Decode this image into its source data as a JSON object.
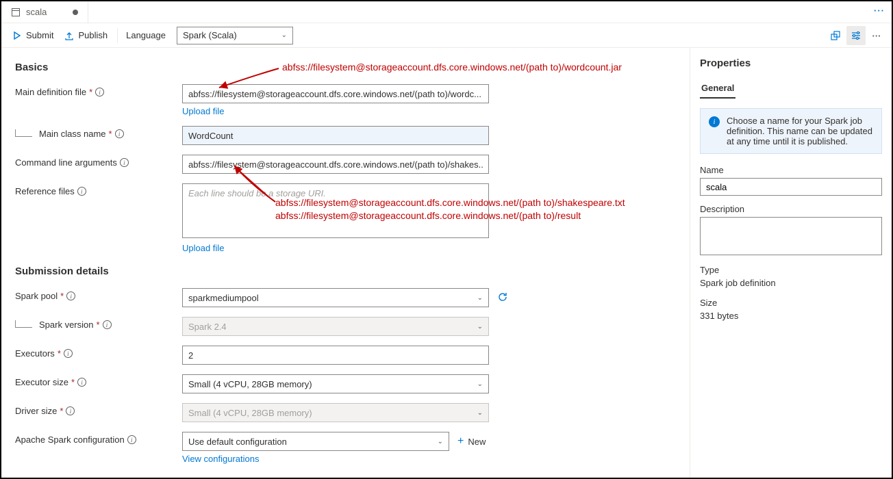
{
  "tab": {
    "title": "scala"
  },
  "toolbar": {
    "submit": "Submit",
    "publish": "Publish",
    "language_label": "Language",
    "language_value": "Spark (Scala)"
  },
  "sections": {
    "basics": "Basics",
    "submission": "Submission details"
  },
  "labels": {
    "main_def": "Main definition file",
    "main_class": "Main class name",
    "cli_args": "Command line arguments",
    "ref_files": "Reference files",
    "spark_pool": "Spark pool",
    "spark_version": "Spark version",
    "executors": "Executors",
    "exec_size": "Executor size",
    "driver_size": "Driver size",
    "spark_conf": "Apache Spark configuration"
  },
  "values": {
    "main_def": "abfss://filesystem@storageaccount.dfs.core.windows.net/(path to)/wordc...",
    "main_class": "WordCount",
    "cli_args": "abfss://filesystem@storageaccount.dfs.core.windows.net/(path to)/shakes...",
    "ref_placeholder": "Each line should be a storage URI.",
    "spark_pool": "sparkmediumpool",
    "spark_version": "Spark 2.4",
    "executors": "2",
    "exec_size": "Small (4 vCPU, 28GB memory)",
    "driver_size": "Small (4 vCPU, 28GB memory)",
    "spark_conf": "Use default configuration"
  },
  "links": {
    "upload": "Upload file",
    "new": "New",
    "view_conf": "View configurations"
  },
  "annotations": {
    "a1": "abfss://filesystem@storageaccount.dfs.core.windows.net/(path to)/wordcount.jar",
    "a2": "abfss://filesystem@storageaccount.dfs.core.windows.net/(path to)/shakespeare.txt",
    "a3": "abfss://filesystem@storageaccount.dfs.core.windows.net/(path to)/result"
  },
  "props": {
    "title": "Properties",
    "tab": "General",
    "info": "Choose a name for your Spark job definition. This name can be updated at any time until it is published.",
    "name_label": "Name",
    "name_value": "scala",
    "desc_label": "Description",
    "type_label": "Type",
    "type_value": "Spark job definition",
    "size_label": "Size",
    "size_value": "331 bytes"
  }
}
